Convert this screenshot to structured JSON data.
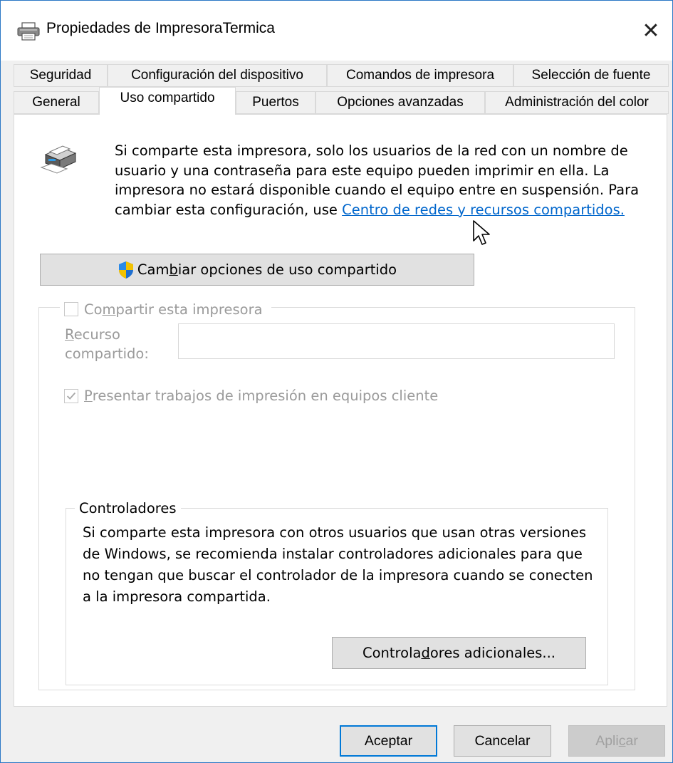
{
  "window": {
    "title": "Propiedades de ImpresoraTermica",
    "close_glyph": "✕",
    "border_color": "#2b78c5"
  },
  "tabs": {
    "row1": [
      "Seguridad",
      "Configuración del dispositivo",
      "Comandos de impresora",
      "Selección de fuente"
    ],
    "row2": [
      "General",
      "Uso compartido",
      "Puertos",
      "Opciones avanzadas",
      "Administración del color"
    ],
    "active": "Uso compartido"
  },
  "sharing": {
    "info_text": "Si comparte esta impresora, solo los usuarios de la red con un nombre de usuario y una contraseña para este equipo pueden imprimir en ella. La impresora no estará disponible cuando el equipo entre en suspensión. Para cambiar esta configuración, use ",
    "info_link": "Centro de redes y recursos compartidos.",
    "change_button_pre": "Cam",
    "change_button_u": "b",
    "change_button_post": "iar opciones de uso compartido",
    "share_checkbox_pre": "Co",
    "share_checkbox_u": "m",
    "share_checkbox_post": "partir esta impresora",
    "share_checked": false,
    "resource_label_u": "R",
    "resource_label_rest1": "ecurso",
    "resource_label_rest2": "compartido:",
    "resource_value": "",
    "render_jobs_u": "P",
    "render_jobs_post": "resentar trabajos de impresión en equipos cliente",
    "render_jobs_checked": true
  },
  "drivers": {
    "legend": "Controladores",
    "text": "Si comparte esta impresora con otros usuarios que usan otras versiones de Windows, se recomienda instalar controladores adicionales para que no tengan que buscar el controlador de la impresora cuando se conecten a la impresora compartida.",
    "button_pre": "Contro la",
    "button_pre_clean": "Contro",
    "button_pre2": "la",
    "button_u": "d",
    "button_post": "ores adicionales..."
  },
  "footer": {
    "ok": "Aceptar",
    "cancel": "Cancelar",
    "apply_pre": "Apli",
    "apply_u": "c",
    "apply_post": "ar"
  },
  "icons": {
    "title": "printer-icon",
    "info": "shared-printer-icon",
    "shield": "uac-shield-icon",
    "cursor": "mouse-cursor-icon"
  },
  "colors": {
    "link": "#0066cc",
    "accent": "#0078d7",
    "disabled_text": "#9a9a9a"
  }
}
